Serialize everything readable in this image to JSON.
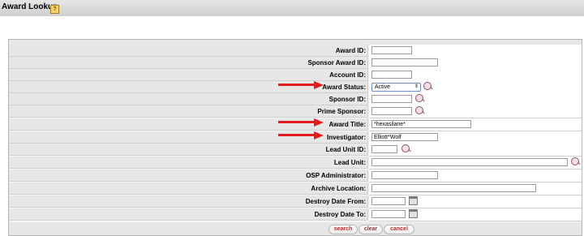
{
  "page": {
    "title": "Award Lookup",
    "help_label": "?"
  },
  "fields": {
    "award_id": {
      "label": "Award ID:",
      "value": ""
    },
    "sponsor_award_id": {
      "label": "Sponsor Award ID:",
      "value": ""
    },
    "account_id": {
      "label": "Account ID:",
      "value": ""
    },
    "award_status": {
      "label": "Award Status:",
      "value": "Active"
    },
    "sponsor_id": {
      "label": "Sponsor ID:",
      "value": ""
    },
    "prime_sponsor": {
      "label": "Prime Sponsor:",
      "value": ""
    },
    "award_title": {
      "label": "Award Title:",
      "value": "*hexasilane*"
    },
    "investigator": {
      "label": "Investigator:",
      "value": "Elliott*Wolf"
    },
    "lead_unit_id": {
      "label": "Lead Unit ID:",
      "value": ""
    },
    "lead_unit": {
      "label": "Lead Unit:",
      "value": ""
    },
    "osp_administrator": {
      "label": "OSP Administrator:",
      "value": ""
    },
    "archive_location": {
      "label": "Archive Location:",
      "value": ""
    },
    "destroy_date_from": {
      "label": "Destroy Date From:",
      "value": ""
    },
    "destroy_date_to": {
      "label": "Destroy Date To:",
      "value": ""
    }
  },
  "buttons": {
    "search": "search",
    "clear": "clear",
    "cancel": "cancel"
  },
  "colors": {
    "annotation_arrow": "#e41b1b",
    "button_text": "#b32d2d"
  },
  "icons": {
    "lookup": "magnifier-lookup-icon",
    "calendar": "calendar-icon",
    "annotation": "red-arrow"
  }
}
